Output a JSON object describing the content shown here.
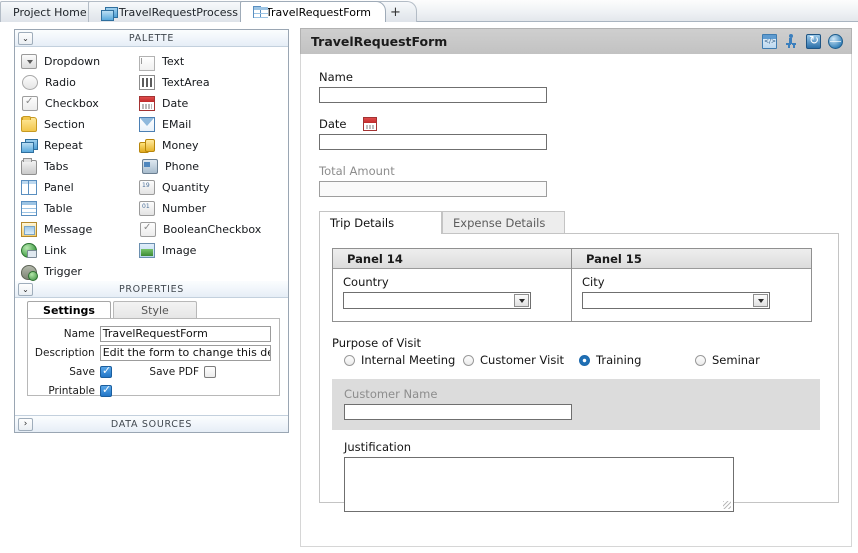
{
  "tabstrip": {
    "tabs": [
      {
        "label": "Project Home",
        "icon": "none",
        "active": false
      },
      {
        "label": "TravelRequestProcess",
        "icon": "process-icon",
        "active": false
      },
      {
        "label": "TravelRequestForm",
        "icon": "form-icon",
        "active": true
      }
    ],
    "add_tab_label": "+"
  },
  "palette": {
    "header": "PALETTE",
    "collapse_icon": "chevron-down-icon",
    "items_left": [
      {
        "label": "Dropdown",
        "icon": "dropdown-icon"
      },
      {
        "label": "Radio",
        "icon": "radio-icon"
      },
      {
        "label": "Checkbox",
        "icon": "checkbox-icon"
      },
      {
        "label": "Section",
        "icon": "section-folder-icon"
      },
      {
        "label": "Repeat",
        "icon": "repeat-icon"
      },
      {
        "label": "Tabs",
        "icon": "tabs-icon"
      },
      {
        "label": "Panel",
        "icon": "panel-icon"
      },
      {
        "label": "Table",
        "icon": "table-icon"
      },
      {
        "label": "Message",
        "icon": "message-icon"
      },
      {
        "label": "Link",
        "icon": "link-icon"
      },
      {
        "label": "Trigger",
        "icon": "trigger-icon"
      }
    ],
    "items_right": [
      {
        "label": "Text",
        "icon": "text-icon"
      },
      {
        "label": "TextArea",
        "icon": "textarea-icon"
      },
      {
        "label": "Date",
        "icon": "date-icon"
      },
      {
        "label": "EMail",
        "icon": "email-icon"
      },
      {
        "label": "Money",
        "icon": "money-icon"
      },
      {
        "label": "Phone",
        "icon": "phone-icon"
      },
      {
        "label": "Quantity",
        "icon": "quantity-icon"
      },
      {
        "label": "Number",
        "icon": "number-icon"
      },
      {
        "label": "BooleanCheckbox",
        "icon": "booleancheckbox-icon"
      },
      {
        "label": "Image",
        "icon": "image-icon"
      }
    ]
  },
  "properties": {
    "header": "PROPERTIES",
    "collapse_icon": "chevron-down-icon",
    "tabs": [
      {
        "label": "Settings",
        "active": true
      },
      {
        "label": "Style",
        "active": false
      }
    ],
    "fields": {
      "name_label": "Name",
      "name_value": "TravelRequestForm",
      "description_label": "Description",
      "description_value": "Edit the form to change this description",
      "save_label": "Save",
      "save_checked": true,
      "save_pdf_label": "Save PDF",
      "save_pdf_checked": false,
      "printable_label": "Printable",
      "printable_checked": true
    }
  },
  "data_sources": {
    "header": "DATA SOURCES",
    "expand_icon": "chevron-right-icon"
  },
  "form": {
    "title": "TravelRequestForm",
    "toolbar_icons": [
      "source-view-icon",
      "run-icon",
      "refresh-icon",
      "globe-preview-icon"
    ],
    "fields": {
      "name_label": "Name",
      "name_value": "",
      "date_label": "Date",
      "date_value": "",
      "date_picker_icon": "calendar-icon",
      "total_amount_label": "Total Amount",
      "total_amount_value": ""
    },
    "tabs": [
      {
        "label": "Trip Details",
        "active": true
      },
      {
        "label": "Expense Details",
        "active": false
      }
    ],
    "panels": [
      {
        "title": "Panel 14",
        "field_label": "Country",
        "field_value": "",
        "dropdown_icon": "chevron-down-icon"
      },
      {
        "title": "Panel 15",
        "field_label": "City",
        "field_value": "",
        "dropdown_icon": "chevron-down-icon"
      }
    ],
    "purpose": {
      "label": "Purpose of Visit",
      "options": [
        {
          "label": "Internal Meeting",
          "selected": false
        },
        {
          "label": "Customer Visit",
          "selected": false
        },
        {
          "label": "Training",
          "selected": true
        },
        {
          "label": "Seminar",
          "selected": false
        }
      ]
    },
    "customer_name": {
      "label": "Customer Name",
      "value": "",
      "disabled": true
    },
    "justification": {
      "label": "Justification",
      "value": ""
    }
  },
  "colors": {
    "tab_active_bg": "#ffffff",
    "form_header_bg": "#c6c6c6",
    "radio_selected": "#1f6fb4",
    "checkbox_checked": "#2176c7",
    "disabled_text": "#8d8d8d",
    "gray_band": "#dcdcdc"
  }
}
